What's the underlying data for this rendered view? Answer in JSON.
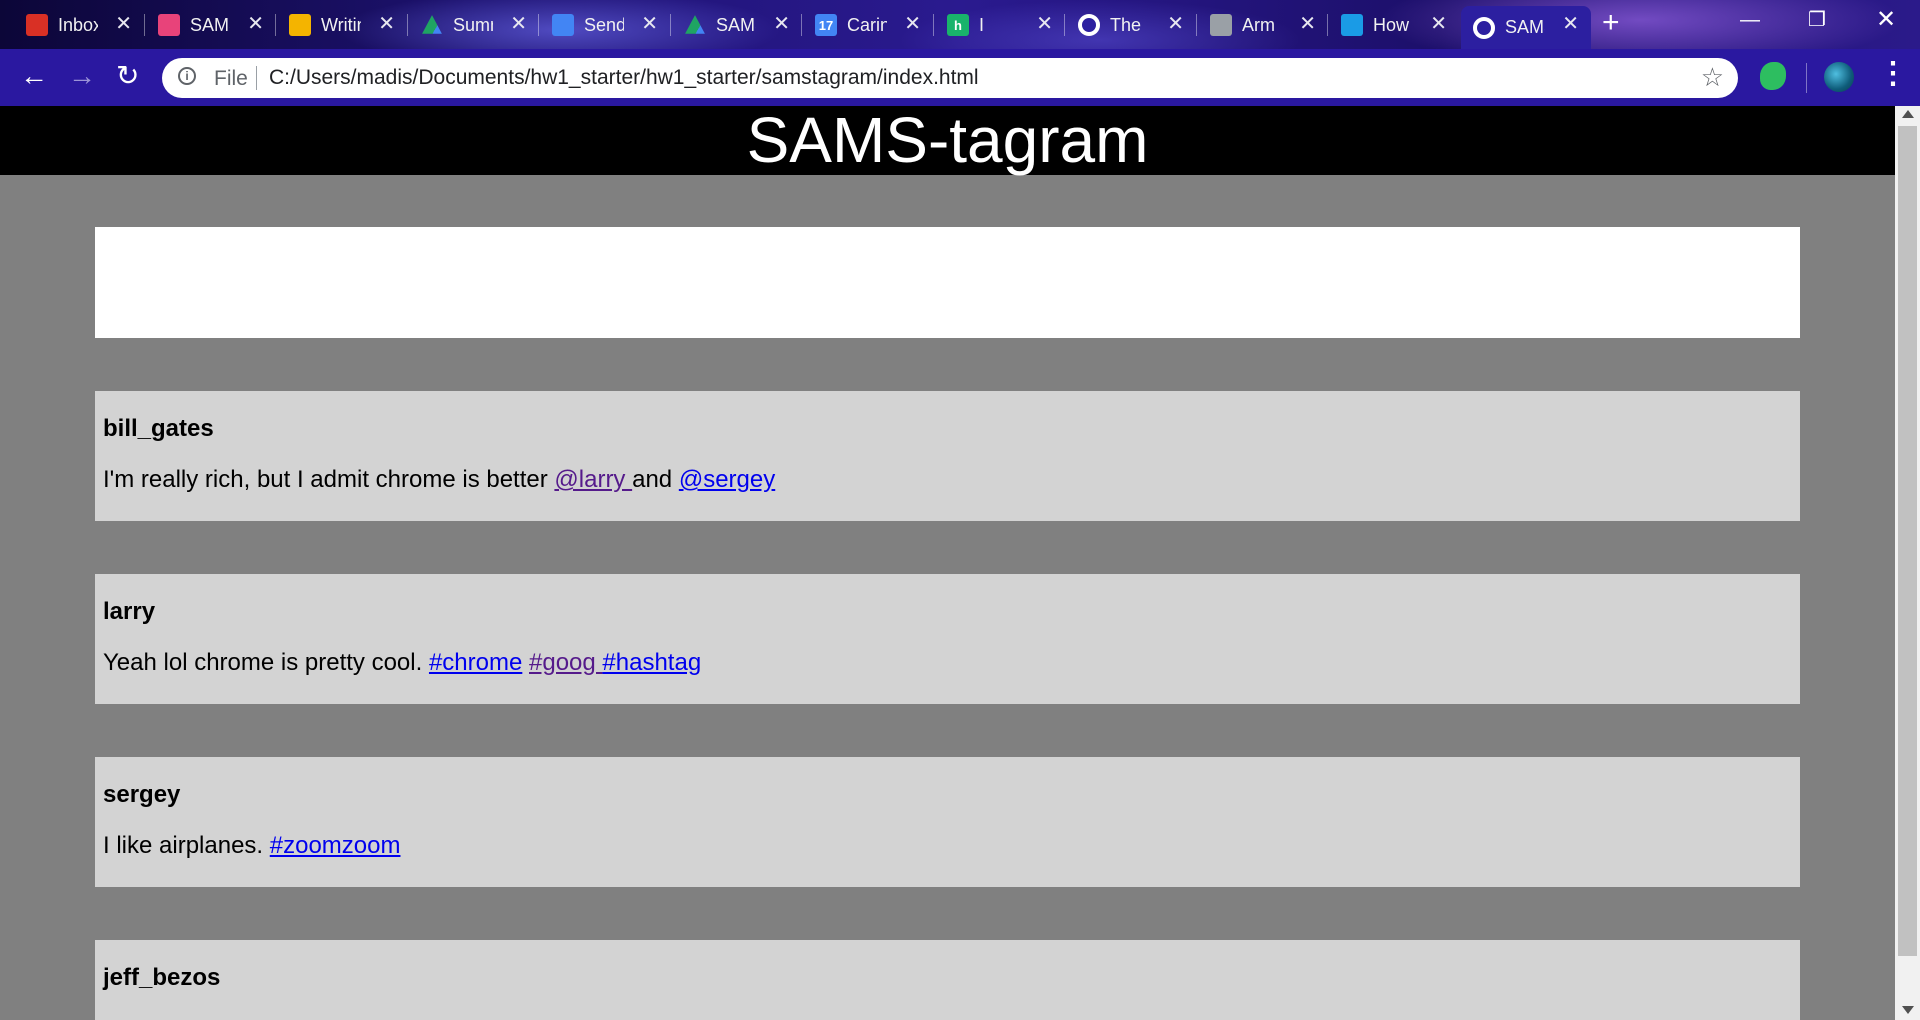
{
  "tabs": [
    {
      "title": "Inbox",
      "icon": "gmail-icon",
      "color": "#d93025"
    },
    {
      "title": "SAMS",
      "icon": "contacts-icon",
      "color": "#e8437a"
    },
    {
      "title": "Writing",
      "icon": "slides-icon",
      "color": "#f4b400"
    },
    {
      "title": "Summary",
      "icon": "drive-icon",
      "color": "#1fa463"
    },
    {
      "title": "Sending",
      "icon": "docs-icon",
      "color": "#4285f4"
    },
    {
      "title": "SAMS",
      "icon": "drive-icon",
      "color": "#1fa463"
    },
    {
      "title": "Caring",
      "icon": "calendar-icon",
      "color": "#4285f4",
      "badge": "17"
    },
    {
      "title": "I",
      "icon": "h-icon",
      "color": "#19b36b",
      "badge": "h"
    },
    {
      "title": "The",
      "icon": "globe-icon",
      "color": "#ffffff"
    },
    {
      "title": "Arm",
      "icon": "wp-icon",
      "color": "#9aa0a6"
    },
    {
      "title": "How",
      "icon": "plus-app-icon",
      "color": "#1a9be6"
    },
    {
      "title": "SAMS",
      "icon": "globe-icon",
      "color": "#ffffff",
      "active": true
    }
  ],
  "toolbar": {
    "file_label": "File",
    "url": "C:/Users/madis/Documents/hw1_starter/hw1_starter/samstagram/index.html"
  },
  "site": {
    "title": "SAMS-tagram"
  },
  "posts": [
    {
      "user": "bill_gates",
      "text": "I'm really rich, but I admit chrome is better ",
      "links": [
        {
          "text": "@larry ",
          "visited": true
        },
        {
          "text": "and ",
          "plain": true
        },
        {
          "text": "@sergey",
          "visited": false
        }
      ]
    },
    {
      "user": "larry",
      "text": "Yeah lol chrome is pretty cool. ",
      "links": [
        {
          "text": "#chrome",
          "visited": false
        },
        {
          "text": " ",
          "plain": true
        },
        {
          "text": "#goog ",
          "visited": true
        },
        {
          "text": "#hashtag",
          "visited": false
        }
      ]
    },
    {
      "user": "sergey",
      "text": "I like airplanes. ",
      "links": [
        {
          "text": "#zoomzoom",
          "visited": false
        }
      ]
    },
    {
      "user": "jeff_bezos",
      "text": "",
      "links": []
    }
  ]
}
